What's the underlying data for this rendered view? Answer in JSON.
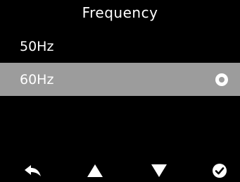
{
  "header": {
    "title": "Frequency"
  },
  "options": [
    {
      "label": "50Hz",
      "selected": false
    },
    {
      "label": "60Hz",
      "selected": true
    }
  ],
  "bottom_bar": {
    "icons": [
      "back-arrow-icon",
      "up-triangle-icon",
      "down-triangle-icon",
      "confirm-check-icon"
    ]
  },
  "colors": {
    "background": "#000000",
    "text": "#ffffff",
    "selected_row": "#9c9c9c"
  }
}
